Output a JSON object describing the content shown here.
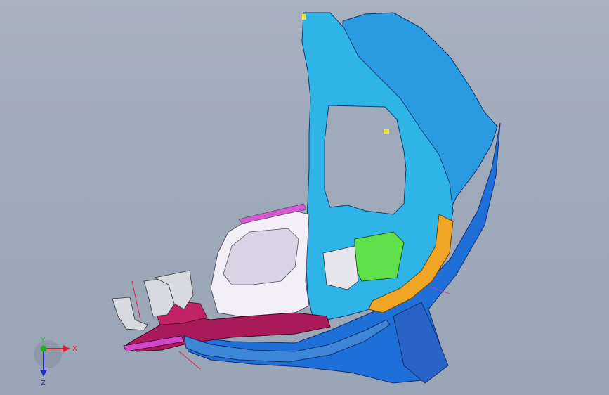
{
  "viewport": {
    "background_top": "#a7b1c0",
    "background_bottom": "#9aa6b7"
  },
  "model": {
    "colors": {
      "frame_blue": "#2fb4e8",
      "frame_blue_dark": "#1288c8",
      "shell_blue": "#1f6fd8",
      "shell_blue_light": "#2a9be0",
      "orange_trim": "#f0a525",
      "green_part": "#5fe04a",
      "white_part": "#f2f0f6",
      "magenta_part": "#a81a5a",
      "magenta_light": "#d85ad0",
      "bracket_gray": "#d8dadf",
      "outline": "#1a1a2e"
    }
  },
  "triad": {
    "x_label": "X",
    "y_label": "Y",
    "z_label": "Z",
    "x_color": "#e02020",
    "y_color": "#20b020",
    "z_color": "#2030d0"
  }
}
